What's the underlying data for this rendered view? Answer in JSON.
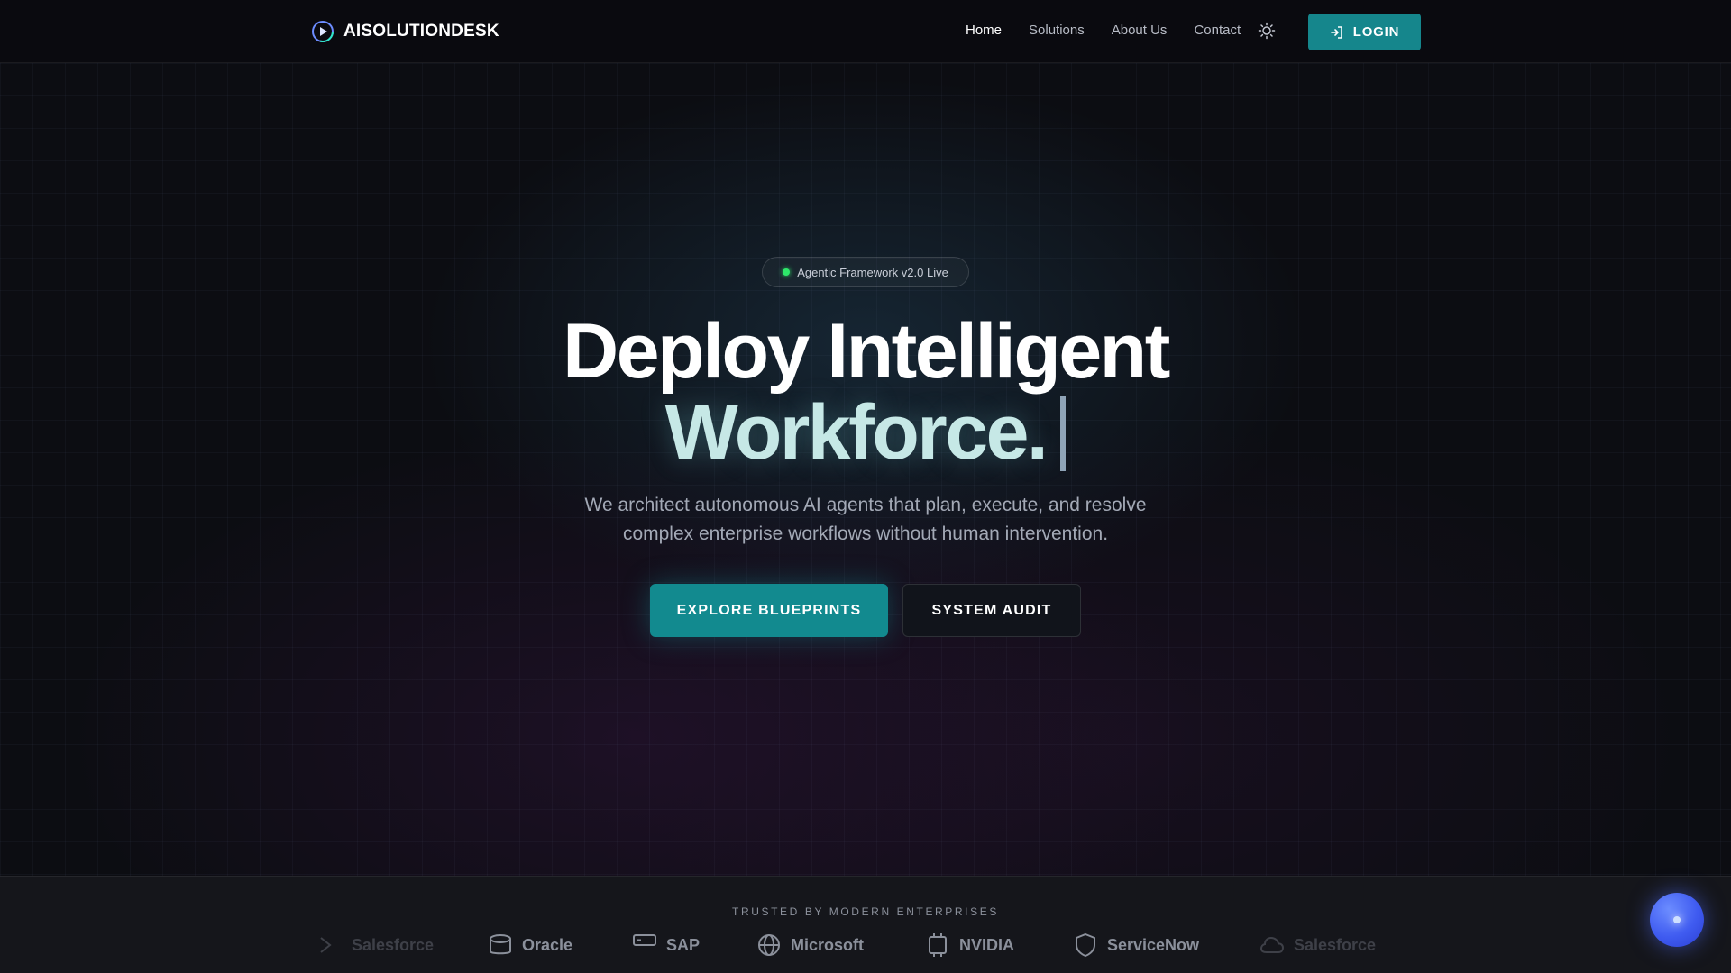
{
  "nav": {
    "brand": "AISOLUTIONDESK",
    "links": [
      "Home",
      "Solutions",
      "About Us",
      "Contact"
    ],
    "active_link": "Home",
    "login_label": "LOGIN"
  },
  "hero": {
    "badge": "Agentic Framework v2.0 Live",
    "title_line1": "Deploy Intelligent",
    "title_line2": "Workforce.",
    "subtitle_line1": "We architect autonomous AI agents that plan, execute, and resolve",
    "subtitle_line2": "complex enterprise workflows without human intervention.",
    "primary_cta": "EXPLORE BLUEPRINTS",
    "secondary_cta": "SYSTEM AUDIT"
  },
  "trusted": {
    "title": "TRUSTED BY MODERN ENTERPRISES",
    "brands": [
      {
        "name": "Salesforce",
        "icon": "arrow-icon"
      },
      {
        "name": "Oracle",
        "icon": "database-icon"
      },
      {
        "name": "SAP",
        "icon": "server-icon"
      },
      {
        "name": "Microsoft",
        "icon": "globe-icon"
      },
      {
        "name": "NVIDIA",
        "icon": "chip-icon"
      },
      {
        "name": "ServiceNow",
        "icon": "shield-icon"
      },
      {
        "name": "Salesforce",
        "icon": "cloud-icon"
      }
    ]
  },
  "colors": {
    "accent": "#128a8f",
    "live_dot": "#2ee86a",
    "chat_fab": "#3f5bf0"
  }
}
